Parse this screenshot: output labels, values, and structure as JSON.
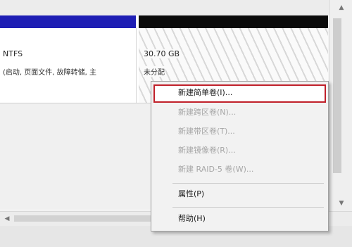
{
  "disk": {
    "ntfs_partition": {
      "fs_label": "NTFS",
      "status_text": "(启动, 页面文件, 故障转储, 主",
      "color": "#1e1eb4"
    },
    "unallocated": {
      "size": "30.70 GB",
      "state": "未分配",
      "color": "#0a0a0a"
    }
  },
  "context_menu": {
    "items": [
      {
        "label": "新建简单卷(I)...",
        "enabled": true,
        "highlighted": true
      },
      {
        "label": "新建跨区卷(N)...",
        "enabled": false
      },
      {
        "label": "新建带区卷(T)...",
        "enabled": false
      },
      {
        "label": "新建镜像卷(R)...",
        "enabled": false
      },
      {
        "label": "新建 RAID-5 卷(W)...",
        "enabled": false
      },
      {
        "label": "属性(P)",
        "enabled": true
      },
      {
        "label": "帮助(H)",
        "enabled": true
      }
    ],
    "highlight_color": "#c0202a"
  },
  "icons": {
    "scroll_up": "▲",
    "scroll_down": "▼",
    "scroll_left": "◀"
  }
}
